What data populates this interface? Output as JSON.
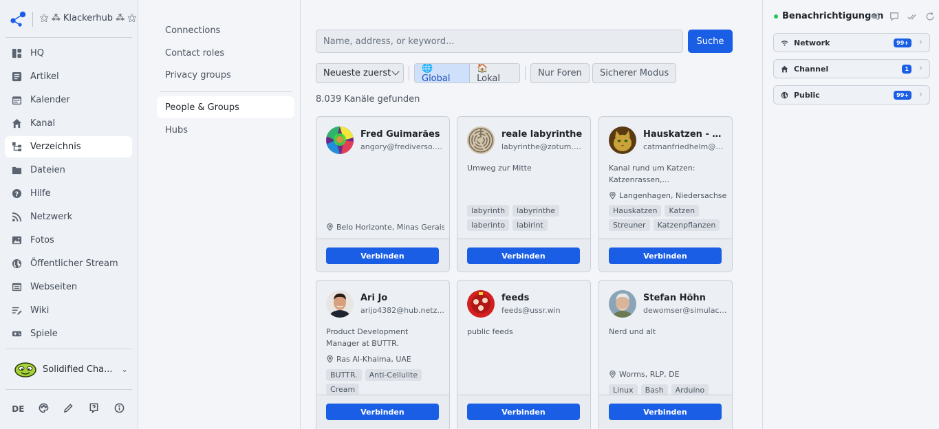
{
  "brand": {
    "name": "⚝ ⁂ Klackerhub ⁂ ⚝"
  },
  "nav": {
    "items": [
      {
        "label": "HQ",
        "icon": "grid-icon"
      },
      {
        "label": "Artikel",
        "icon": "article-icon"
      },
      {
        "label": "Kalender",
        "icon": "calendar-icon"
      },
      {
        "label": "Kanal",
        "icon": "home-icon"
      },
      {
        "label": "Verzeichnis",
        "icon": "directory-icon",
        "active": true
      },
      {
        "label": "Dateien",
        "icon": "folder-icon"
      },
      {
        "label": "Hilfe",
        "icon": "help-icon"
      },
      {
        "label": "Netzwerk",
        "icon": "rss-icon"
      },
      {
        "label": "Fotos",
        "icon": "image-icon"
      },
      {
        "label": "Öffentlicher Stream",
        "icon": "globe-icon"
      },
      {
        "label": "Webseiten",
        "icon": "window-icon"
      },
      {
        "label": "Wiki",
        "icon": "wiki-icon"
      },
      {
        "label": "Spiele",
        "icon": "controller-icon"
      }
    ],
    "user": {
      "name": "Solidified Cha..."
    },
    "footer": {
      "lang": "DE"
    }
  },
  "subnav": {
    "items": [
      {
        "label": "Connections"
      },
      {
        "label": "Contact roles"
      },
      {
        "label": "Privacy groups"
      },
      {
        "label": "People & Groups",
        "active": true
      },
      {
        "label": "Hubs"
      }
    ]
  },
  "search": {
    "placeholder": "Name, address, or keyword...",
    "button": "Suche"
  },
  "filters": {
    "sort": "Neueste zuerst",
    "global": "🌐 Global",
    "local": "🏠 Lokal",
    "forums": "Nur Foren",
    "safe": "Sicherer Modus"
  },
  "results": {
    "count_text": "8.039 Kanäle gefunden"
  },
  "cards": [
    {
      "name": "Fred Guimarães",
      "address": "angory@frediverso.s...",
      "description": "",
      "location": "Belo Horizonte, Minas Gerais,",
      "tags": [],
      "button": "Verbinden"
    },
    {
      "name": "reale labyrinthe",
      "address": "labyrinthe@zotum.net",
      "description": "Umweg zur Mitte",
      "location": "",
      "tags": [
        "labyrinth",
        "labyrinthe",
        "laberinto",
        "labirint"
      ],
      "button": "Verbinden"
    },
    {
      "name": "Hauskatzen - Pr...",
      "address": "catmanfriedhelm@h...",
      "description": "Kanal rund um Katzen: Katzenrassen,...",
      "location": "Langenhagen, Niedersachsen",
      "tags": [
        "Hauskatzen",
        "Katzen",
        "Streuner",
        "Katzenpflanzen"
      ],
      "button": "Verbinden"
    },
    {
      "name": "Ari Jo",
      "address": "arijo4382@hub.netz...",
      "description": "Product Development Manager at BUTTR.",
      "location": "Ras Al-Khaima, UAE",
      "tags": [
        "BUTTR.",
        "Anti-Cellulite",
        "Cream"
      ],
      "button": "Verbinden"
    },
    {
      "name": "feeds",
      "address": "feeds@ussr.win",
      "description": "public feeds",
      "location": "",
      "tags": [],
      "button": "Verbinden"
    },
    {
      "name": "Stefan Höhn",
      "address": "dewomser@simulacr...",
      "description": "Nerd und alt",
      "location": "Worms, RLP, DE",
      "tags": [
        "Linux",
        "Bash",
        "Arduino"
      ],
      "button": "Verbinden"
    }
  ],
  "notifications": {
    "title": "Benachrichtigungen",
    "items": [
      {
        "label": "Network",
        "badge": "99+",
        "icon": "wifi-icon"
      },
      {
        "label": "Channel",
        "badge": "1",
        "icon": "home-icon"
      },
      {
        "label": "Public",
        "badge": "99+",
        "icon": "globe-icon"
      }
    ]
  },
  "colors": {
    "accent": "#1a5ee6",
    "online": "#22c55e"
  }
}
